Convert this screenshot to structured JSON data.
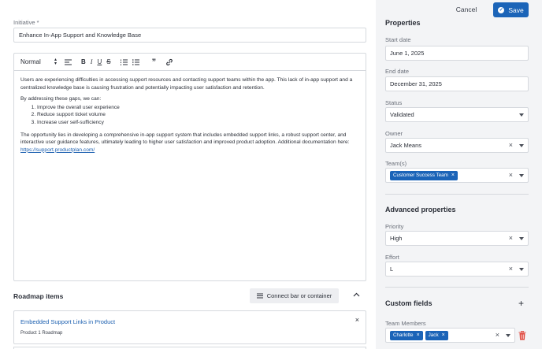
{
  "header": {
    "cancel_label": "Cancel",
    "save_label": "Save"
  },
  "initiative": {
    "label": "Initiative *",
    "value": "Enhance In-App Support and Knowledge Base"
  },
  "editor": {
    "heading_select": "Normal",
    "toolbar_icons": [
      "align-icon",
      "bold-icon",
      "italic-icon",
      "underline-icon",
      "strikethrough-icon",
      "ordered-list-icon",
      "bullet-list-icon",
      "quote-icon",
      "link-icon"
    ],
    "para1": "Users are experiencing difficulties in accessing support resources and contacting support teams within the app. This lack of in-app support and a centralized knowledge base is causing frustration and potentially impacting user satisfaction and retention.",
    "para2": "By addressing these gaps, we can:",
    "list": [
      "Improve the overall user experience",
      "Reduce support ticket volume",
      "Increase user self-sufficiency"
    ],
    "para3": "The opportunity lies in developing a comprehensive in-app support system that includes embedded support links, a robust support center, and interactive user guidance features, ultimately leading to higher user satisfaction and improved product adoption. Additional documentation here: ",
    "link": "https://support.productplan.com/"
  },
  "roadmap": {
    "title": "Roadmap items",
    "connect_label": "Connect bar or container",
    "items": [
      {
        "title": "Embedded Support Links in Product",
        "subtitle": "Product 1 Roadmap"
      }
    ]
  },
  "properties": {
    "title": "Properties",
    "start_date": {
      "label": "Start date",
      "value": "June 1, 2025"
    },
    "end_date": {
      "label": "End date",
      "value": "December 31, 2025"
    },
    "status": {
      "label": "Status",
      "value": "Validated"
    },
    "owner": {
      "label": "Owner",
      "value": "Jack Means"
    },
    "teams": {
      "label": "Team(s)",
      "chips": [
        "Customer Success Team"
      ]
    }
  },
  "advanced": {
    "title": "Advanced properties",
    "priority": {
      "label": "Priority",
      "value": "High"
    },
    "effort": {
      "label": "Effort",
      "value": "L"
    }
  },
  "custom": {
    "title": "Custom fields",
    "team_members": {
      "label": "Team Members",
      "chips": [
        "Charlotte",
        "Jack"
      ]
    }
  },
  "colors": {
    "accent": "#1b64b8",
    "link": "#1b5fb0",
    "danger": "#e0483e",
    "panel_bg": "#f3f4f6"
  }
}
